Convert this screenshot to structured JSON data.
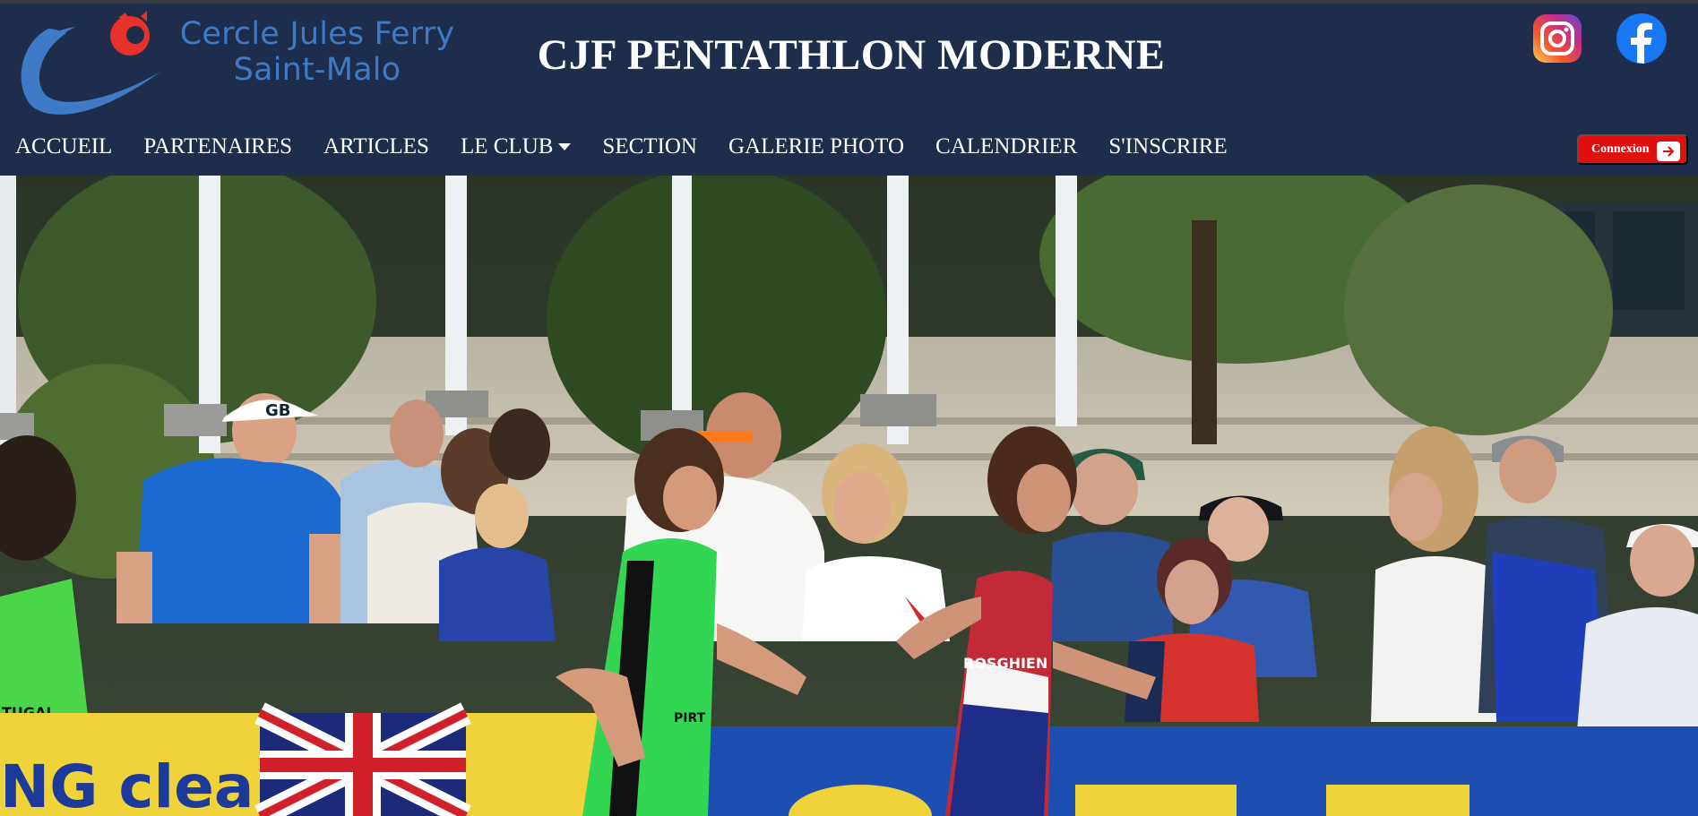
{
  "logo": {
    "line1": "Cercle Jules Ferry",
    "line2": "Saint-Malo"
  },
  "site_title": "CJF PENTATHLON MODERNE",
  "social": {
    "instagram_icon": "instagram-icon",
    "facebook_icon": "facebook-icon"
  },
  "nav": {
    "items": [
      {
        "label": "ACCUEIL"
      },
      {
        "label": "PARTENAIRES"
      },
      {
        "label": "ARTICLES"
      },
      {
        "label": "LE CLUB",
        "has_dropdown": true
      },
      {
        "label": "SECTION"
      },
      {
        "label": "GALERIE PHOTO"
      },
      {
        "label": "CALENDRIER"
      },
      {
        "label": "S'INSCRIRE"
      }
    ]
  },
  "login": {
    "label": "Connexion",
    "icon": "arrow-right-icon"
  },
  "hero": {
    "athlete_tag_1": "PIRT",
    "athlete_tag_2": "ROSGHIEN",
    "cap_text": "GB",
    "banner_text": "NG clea",
    "shirt_text": "TUGAL"
  },
  "colors": {
    "header_bg": "#1e2d4b",
    "logo_blue": "#3f7ac6",
    "logo_red": "#e8312a",
    "login_red": "#e01010",
    "facebook_blue": "#1877f2"
  }
}
